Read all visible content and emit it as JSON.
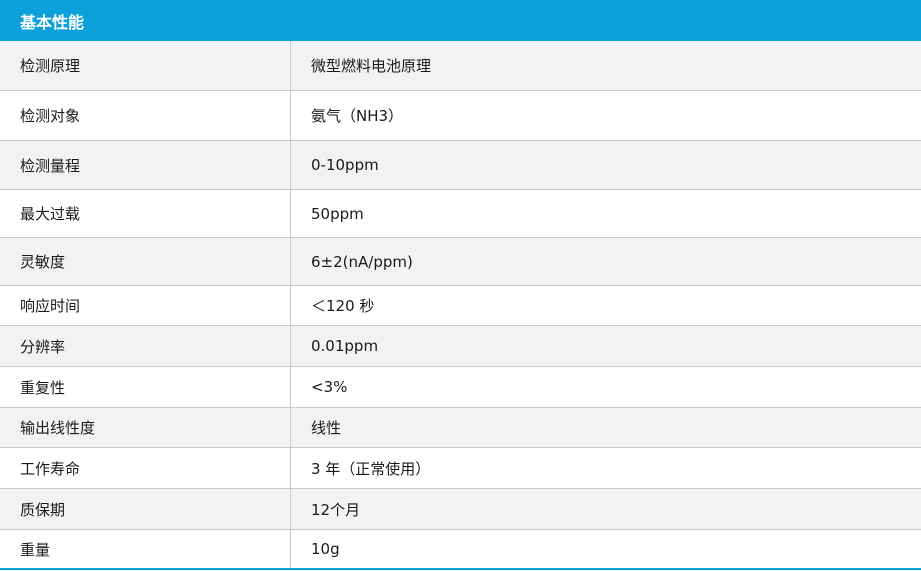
{
  "header": {
    "title": "基本性能"
  },
  "rows": [
    {
      "label": "检测原理",
      "value": "微型燃料电池原理"
    },
    {
      "label": "检测对象",
      "value": "氨气（NH3）"
    },
    {
      "label": "检测量程",
      "value": "0-10ppm"
    },
    {
      "label": "最大过载",
      "value": "50ppm"
    },
    {
      "label": "灵敏度",
      "value": "6±2(nA/ppm)"
    },
    {
      "label": "响应时间",
      "value": "＜120 秒"
    },
    {
      "label": "分辨率",
      "value": "0.01ppm"
    },
    {
      "label": "重复性",
      "value": "<3%"
    },
    {
      "label": "输出线性度",
      "value": "线性"
    },
    {
      "label": "工作寿命",
      "value": "3 年（正常使用）"
    },
    {
      "label": "质保期",
      "value": "12个月"
    },
    {
      "label": "重量",
      "value": "10g"
    }
  ],
  "colors": {
    "header_bg": "#0ba0da",
    "shade_row": "#f2f2f2",
    "border": "#c9c9c9"
  }
}
